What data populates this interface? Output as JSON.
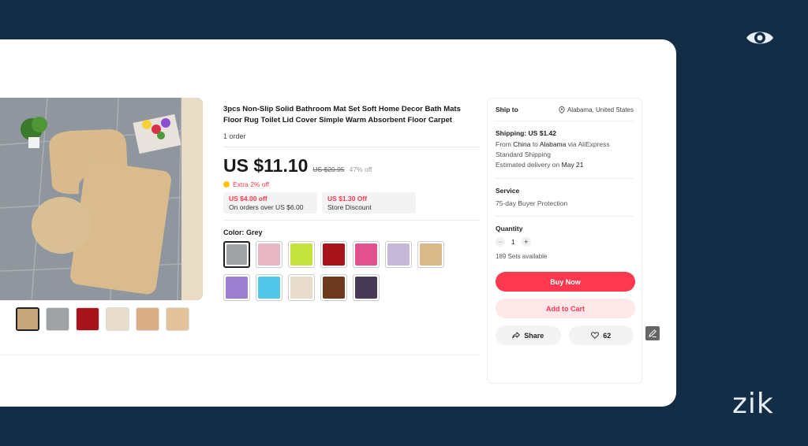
{
  "brand": "zik",
  "product": {
    "title": "3pcs Non-Slip Solid Bathroom Mat Set Soft Home Decor Bath Mats Floor Rug Toilet Lid Cover Simple Warm Absorbent Floor Carpet",
    "orders": "1 order",
    "price": "US $11.10",
    "original_price": "US $20.95",
    "discount": "47% off",
    "extra_off": "Extra 2% off",
    "coupons": [
      {
        "amount": "US $4.00 off",
        "condition": "On orders over US $6.00"
      },
      {
        "amount": "US $1.30 Off",
        "condition": "Store Discount"
      }
    ],
    "color_label": "Color: Grey",
    "swatches": [
      {
        "name": "grey",
        "color": "#9ea2a4"
      },
      {
        "name": "pink",
        "color": "#e8b7c6"
      },
      {
        "name": "lime",
        "color": "#c6e23c"
      },
      {
        "name": "red",
        "color": "#a9141c"
      },
      {
        "name": "rose",
        "color": "#e1518d"
      },
      {
        "name": "lilac",
        "color": "#c5b7d6"
      },
      {
        "name": "beige",
        "color": "#d7b98a"
      },
      {
        "name": "purple",
        "color": "#9b7fcf"
      },
      {
        "name": "sky-blue",
        "color": "#53c7ea"
      },
      {
        "name": "cream",
        "color": "#e7dccb"
      },
      {
        "name": "brown",
        "color": "#6e3a1f"
      },
      {
        "name": "dark-purple",
        "color": "#473a55"
      }
    ],
    "thumbnails": [
      {
        "color": "#c8a77d"
      },
      {
        "color": "#9ea2a4"
      },
      {
        "color": "#a9141c"
      },
      {
        "color": "#e7dccb"
      },
      {
        "color": "#dcae88"
      },
      {
        "color": "#e3c49a"
      }
    ]
  },
  "shipping_panel": {
    "ship_to_label": "Ship to",
    "location": "Alabama, United States",
    "shipping_cost": "Shipping: US $1.42",
    "route_prefix": "From",
    "route_from": "China",
    "route_to_word": "to",
    "route_to": "Alabama",
    "route_via": "via AliExpress Standard Shipping",
    "delivery_prefix": "Estimated delivery on",
    "delivery_date": "May 21",
    "service_label": "Service",
    "service_value": "75-day Buyer Protection",
    "quantity_label": "Quantity",
    "quantity_value": "1",
    "available": "189 Sets available",
    "buy_now": "Buy Now",
    "add_to_cart": "Add to Cart",
    "share": "Share",
    "wishlist_count": "62"
  },
  "colors": {
    "accent": "#fd384f",
    "background": "#142d46"
  }
}
